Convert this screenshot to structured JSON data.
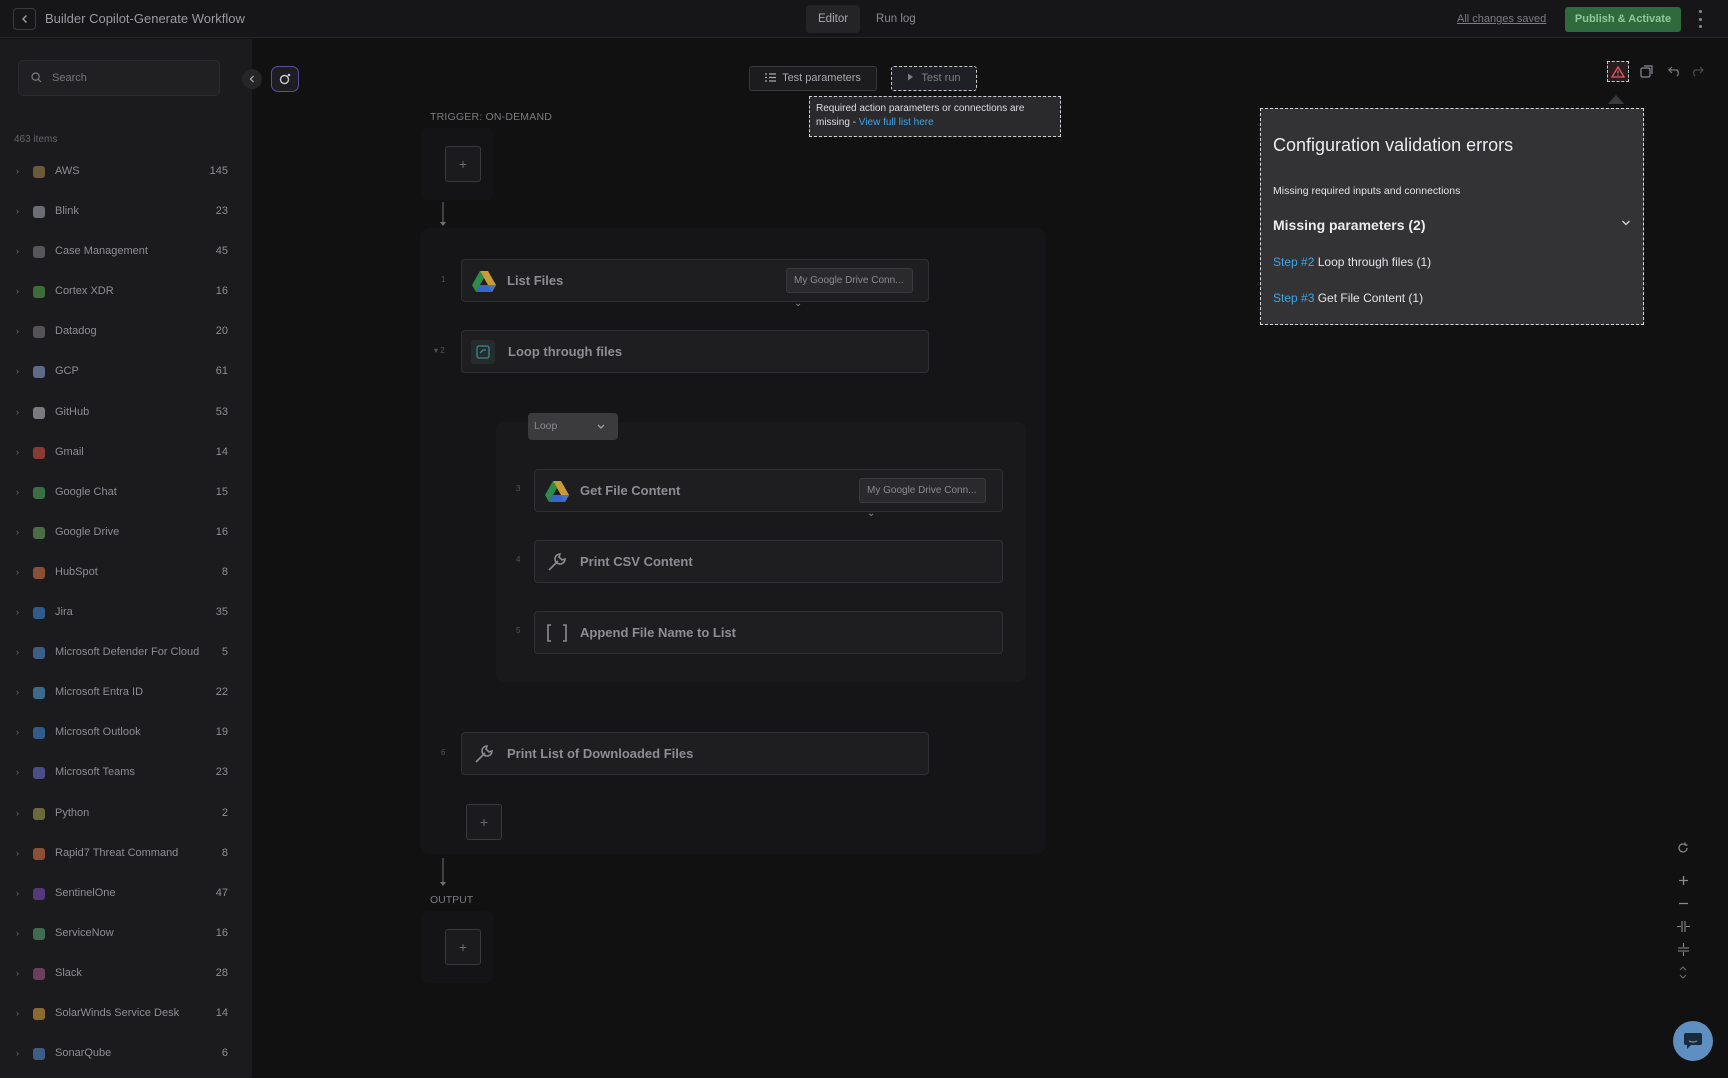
{
  "header": {
    "title": "Builder Copilot-Generate Workflow",
    "tabs": [
      "Editor",
      "Run log"
    ],
    "active_tab": "Editor",
    "saved_status": "All changes saved",
    "publish_label": "Publish & Activate"
  },
  "sidebar": {
    "search_placeholder": "Search",
    "items_count": "463 items",
    "items": [
      {
        "label": "AWS",
        "count": "145",
        "icon_color": "#6b5a3a"
      },
      {
        "label": "Blink",
        "count": "23",
        "icon_color": "#6c6c74"
      },
      {
        "label": "Case Management",
        "count": "45",
        "icon_color": "#55555b"
      },
      {
        "label": "Cortex XDR",
        "count": "16",
        "icon_color": "#3f6b3a"
      },
      {
        "label": "Datadog",
        "count": "20",
        "icon_color": "#56525a"
      },
      {
        "label": "GCP",
        "count": "61",
        "icon_color": "#5c6b86"
      },
      {
        "label": "GitHub",
        "count": "53",
        "icon_color": "#7a7a80"
      },
      {
        "label": "Gmail",
        "count": "14",
        "icon_color": "#8a3a34"
      },
      {
        "label": "Google Chat",
        "count": "15",
        "icon_color": "#3b6e45"
      },
      {
        "label": "Google Drive",
        "count": "16",
        "icon_color": "#4a6d46"
      },
      {
        "label": "HubSpot",
        "count": "8",
        "icon_color": "#8a4f34"
      },
      {
        "label": "Jira",
        "count": "35",
        "icon_color": "#2f5a8a"
      },
      {
        "label": "Microsoft Defender For Cloud",
        "count": "5",
        "icon_color": "#3d5d86"
      },
      {
        "label": "Microsoft Entra ID",
        "count": "22",
        "icon_color": "#3d6a8a"
      },
      {
        "label": "Microsoft Outlook",
        "count": "19",
        "icon_color": "#2f5c8a"
      },
      {
        "label": "Microsoft Teams",
        "count": "23",
        "icon_color": "#4b4d86"
      },
      {
        "label": "Python",
        "count": "2",
        "icon_color": "#6b6a3a"
      },
      {
        "label": "Rapid7 Threat Command",
        "count": "8",
        "icon_color": "#8a4f34"
      },
      {
        "label": "SentinelOne",
        "count": "47",
        "icon_color": "#55387a"
      },
      {
        "label": "ServiceNow",
        "count": "16",
        "icon_color": "#3f6b50"
      },
      {
        "label": "Slack",
        "count": "28",
        "icon_color": "#6b3f5c"
      },
      {
        "label": "SolarWinds Service Desk",
        "count": "14",
        "icon_color": "#8a6a2f"
      },
      {
        "label": "SonarQube",
        "count": "6",
        "icon_color": "#3d5d86"
      }
    ]
  },
  "canvas": {
    "test_params_label": "Test parameters",
    "test_run_label": "Test run",
    "tooltip_text": "Required action parameters or connections are missing - ",
    "tooltip_link": "View full list here",
    "trigger_label": "TRIGGER: ON-DEMAND",
    "output_label": "OUTPUT",
    "plus": "+",
    "loop_label": "Loop",
    "steps": [
      {
        "num": "1",
        "name": "List Files",
        "connection": "My Google Drive Conn..."
      },
      {
        "num": "2",
        "name": "Loop through files"
      },
      {
        "num": "3",
        "name": "Get File Content",
        "connection": "My Google Drive Conn..."
      },
      {
        "num": "4",
        "name": "Print CSV Content"
      },
      {
        "num": "5",
        "name": "Append File Name to List"
      },
      {
        "num": "6",
        "name": "Print List of Downloaded Files"
      }
    ]
  },
  "validation_panel": {
    "title": "Configuration validation errors",
    "subtitle": "Missing required inputs and connections",
    "section": "Missing parameters (2)",
    "rows": [
      {
        "step": "Step #2",
        "text": "Loop through files (1)"
      },
      {
        "step": "Step #3",
        "text": "Get File Content (1)"
      }
    ]
  }
}
